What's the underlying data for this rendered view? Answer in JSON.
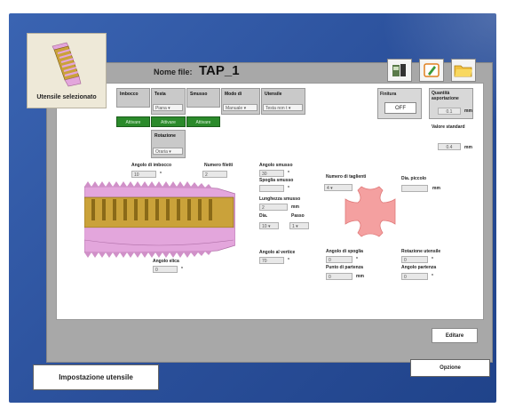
{
  "tool_box": {
    "label": "Utensile selezionato"
  },
  "file": {
    "label": "Nome file:",
    "name": "TAP_1"
  },
  "toolbar": {
    "icons": [
      "machine-icon",
      "edit-icon",
      "folder-icon"
    ]
  },
  "groups": {
    "imbocco": {
      "label": "Imbocco",
      "button": "Attivare"
    },
    "testa": {
      "label": "Testa",
      "select": "Piana",
      "button": "Attivare"
    },
    "smusso": {
      "label": "Smusso",
      "button": "Attivare"
    },
    "modo": {
      "label": "Modo di",
      "select": "Manuale"
    },
    "utensile": {
      "label": "Utensile",
      "select": "Testa non t"
    },
    "rotazione": {
      "label": "Rotazione",
      "select": "Oraria"
    }
  },
  "finitura": {
    "label": "Finitura",
    "value": "OFF"
  },
  "quantita": {
    "label": "Quantità asportazione",
    "value": "0.1",
    "unit": "mm"
  },
  "valore": {
    "label": "Valore standard",
    "value": "0.4",
    "unit": "mm"
  },
  "params": {
    "angolo_imbocco": {
      "label": "Angolo di imbocco",
      "value": "10",
      "unit": "°"
    },
    "numero_filetti": {
      "label": "Numero filetti",
      "value": "2"
    },
    "angolo_smusso": {
      "label": "Angolo smusso",
      "value": "30",
      "unit": "°"
    },
    "spoglia_smusso": {
      "label": "Spoglia smusso",
      "value": "",
      "unit": "°"
    },
    "lunghezza_smusso": {
      "label": "Lunghezza smusso",
      "value": "2",
      "unit": "mm"
    },
    "dia": {
      "label": "Dia.",
      "value": "10"
    },
    "passo": {
      "label": "Passo",
      "value": "1"
    },
    "angolo_vertice": {
      "label": "Angolo al vertice",
      "value": "70",
      "unit": "°"
    },
    "angolo_elica": {
      "label": "Angolo elica",
      "value": "0",
      "unit": "°"
    },
    "numero_taglienti": {
      "label": "Numero di taglienti",
      "value": "4"
    },
    "dia_piccolo": {
      "label": "Dia. piccolo",
      "value": "",
      "unit": "mm"
    },
    "angolo_spoglia": {
      "label": "Angolo di spoglia",
      "value": "0",
      "unit": "°"
    },
    "rotazione_utensile": {
      "label": "Rotazione utensile",
      "value": "0",
      "unit": "°"
    },
    "punto_partenza": {
      "label": "Punto di partenza",
      "value": "0",
      "unit": "mm"
    },
    "angolo_partenza": {
      "label": "Angolo partenza",
      "value": "0",
      "unit": "°"
    }
  },
  "buttons": {
    "editare": "Editare",
    "opzione": "Opzione"
  },
  "footer": {
    "title": "Impostazione utensile"
  },
  "colors": {
    "background": "#2a4f9a",
    "panel": "#a8a8a8",
    "active_green": "#2b8a2b",
    "cross_section": "#f4a0a0",
    "tap_pink": "#e3a6dc",
    "tap_gold": "#caa23a"
  }
}
